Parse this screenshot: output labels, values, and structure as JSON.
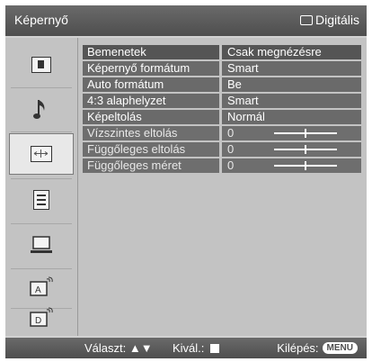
{
  "header": {
    "title": "Képernyő",
    "input_label": "Digitális"
  },
  "sidebar": {
    "items": [
      {
        "name": "picture-icon"
      },
      {
        "name": "sound-icon"
      },
      {
        "name": "screen-icon"
      },
      {
        "name": "settings-list-icon"
      },
      {
        "name": "pc-icon"
      },
      {
        "name": "analog-setup-icon"
      },
      {
        "name": "digital-setup-icon"
      }
    ],
    "selected_index": 2
  },
  "menu": {
    "rows": [
      {
        "label": "Bemenetek",
        "value": "Csak megnézésre"
      },
      {
        "label": "Képernyő formátum",
        "value": "Smart"
      },
      {
        "label": "Auto formátum",
        "value": "Be"
      },
      {
        "label": "4:3 alaphelyzet",
        "value": "Smart"
      },
      {
        "label": "Képeltolás",
        "value": "Normál"
      },
      {
        "label": "Vízszintes eltolás",
        "value": "0",
        "slider_position": 0.5
      },
      {
        "label": "Függőleges eltolás",
        "value": "0",
        "slider_position": 0.5
      },
      {
        "label": "Függőleges méret",
        "value": "0",
        "slider_position": 0.5
      }
    ]
  },
  "footer": {
    "select_text": "Választ:",
    "enter_text": "Kivál.:",
    "exit_text": "Kilépés:",
    "exit_key": "MENU"
  }
}
